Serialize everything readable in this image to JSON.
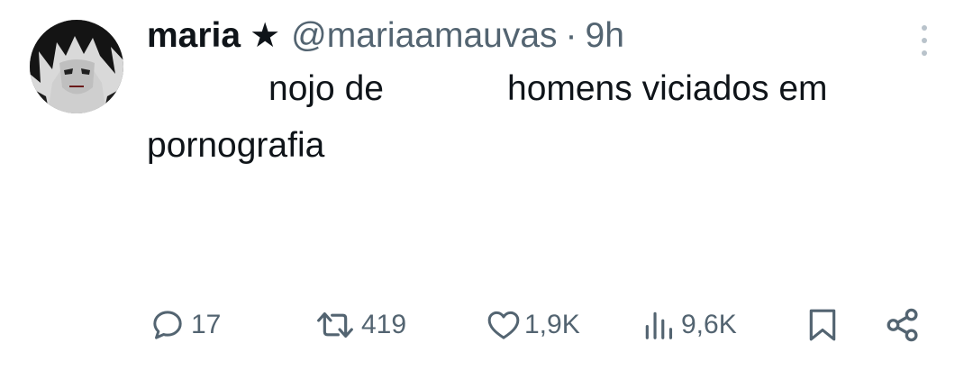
{
  "tweet": {
    "display_name": "maria",
    "star": "★",
    "handle": "@mariaamauvas",
    "separator": "·",
    "time": "9h",
    "text_segment_1": "nojo de",
    "text_segment_2": "homens viciados em",
    "text_line_2": "pornografia"
  },
  "actions": {
    "replies": "17",
    "retweets": "419",
    "likes": "1,9K",
    "views": "9,6K"
  },
  "icons": {
    "more": "more-vertical-icon",
    "reply": "reply-icon",
    "retweet": "retweet-icon",
    "like": "heart-icon",
    "views": "views-chart-icon",
    "bookmark": "bookmark-icon",
    "share": "share-icon"
  },
  "colors": {
    "text_primary": "#0f1419",
    "text_secondary": "#536471"
  }
}
